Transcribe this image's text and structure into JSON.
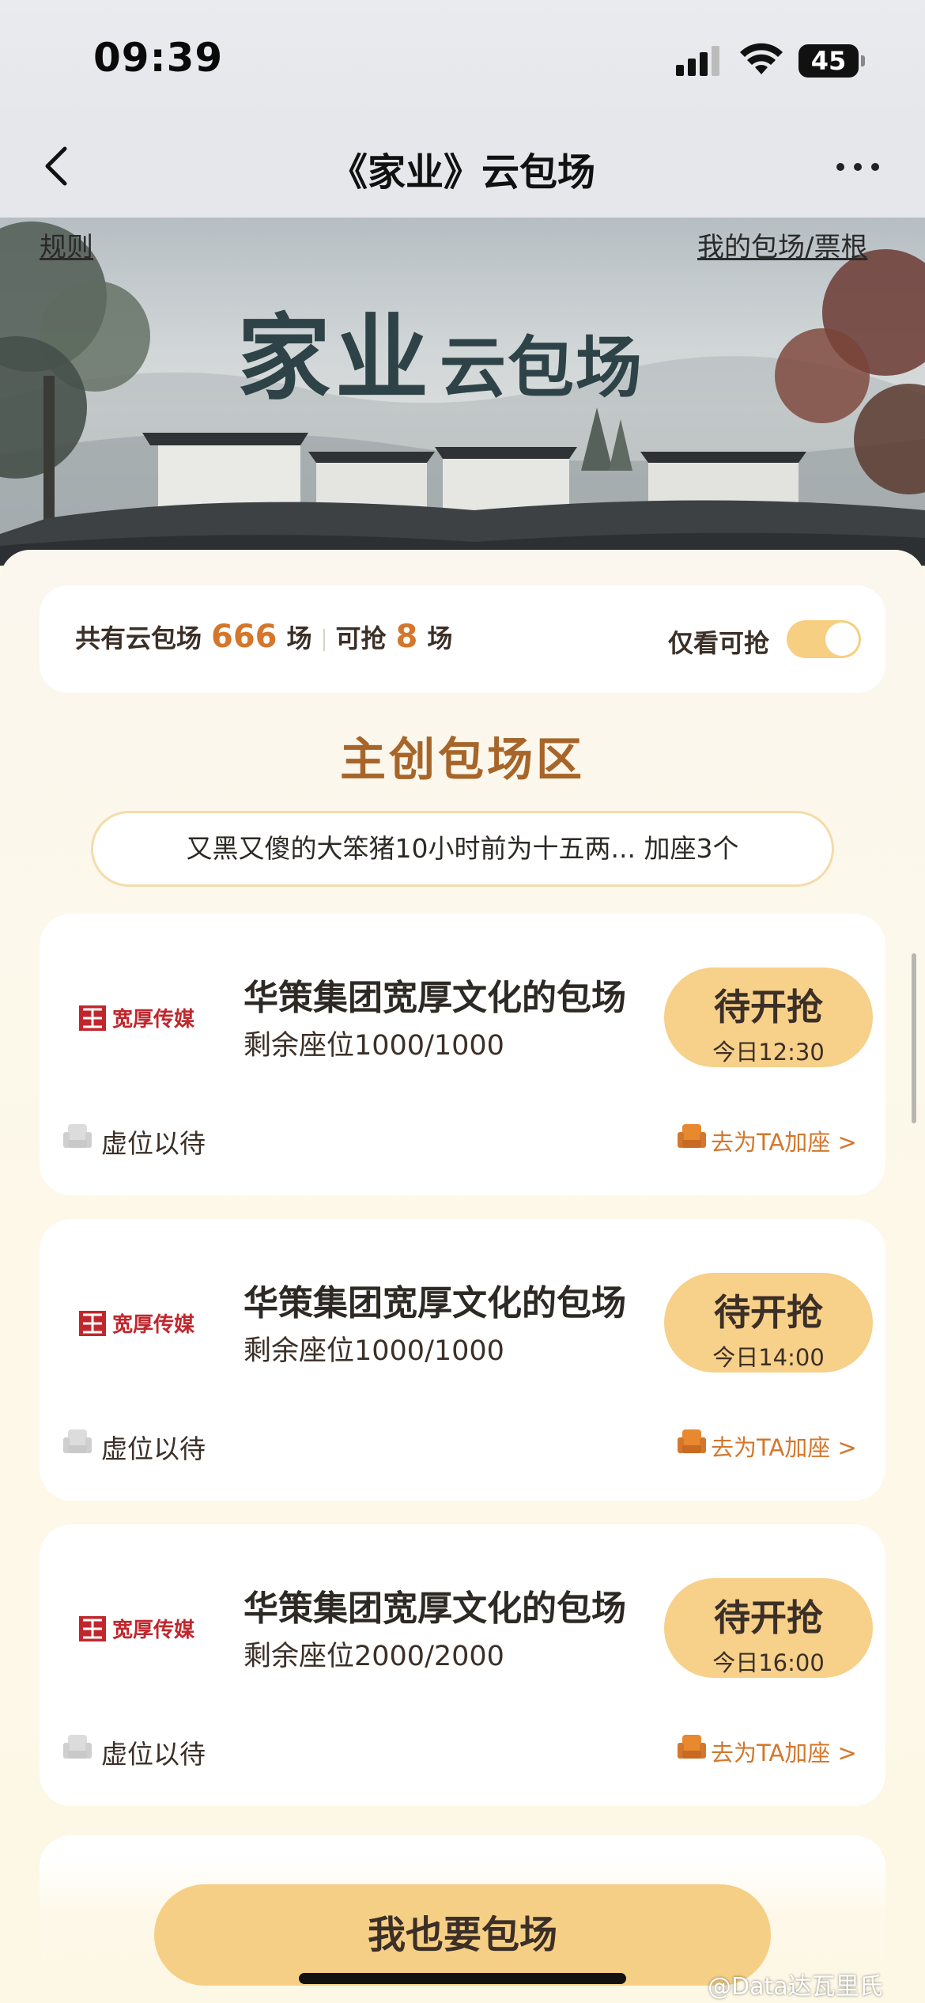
{
  "status_bar": {
    "time": "09:39",
    "battery": "45"
  },
  "nav": {
    "title": "《家业》云包场"
  },
  "banner": {
    "rules_link": "规则",
    "my_link": "我的包场/票根",
    "title_big": "家业",
    "title_small": "云包场"
  },
  "summary": {
    "total_prefix": "共有云包场",
    "total_count": "666",
    "total_unit": "场",
    "avail_prefix": "可抢",
    "avail_count": "8",
    "avail_unit": "场",
    "toggle_label": "仅看可抢",
    "toggle_on": true
  },
  "section_title": "主创包场区",
  "marquee_text": "又黑又傻的大笨猪10小时前为十五两... 加座3个",
  "events": [
    {
      "title": "华策集团宽厚文化的包场",
      "seats": "剩余座位1000/1000",
      "status": "待开抢",
      "time": "今日12:30",
      "wait": "虚位以待",
      "add": "去为TA加座 >"
    },
    {
      "title": "华策集团宽厚文化的包场",
      "seats": "剩余座位1000/1000",
      "status": "待开抢",
      "time": "今日14:00",
      "wait": "虚位以待",
      "add": "去为TA加座 >"
    },
    {
      "title": "华策集团宽厚文化的包场",
      "seats": "剩余座位2000/2000",
      "status": "待开抢",
      "time": "今日16:00",
      "wait": "虚位以待",
      "add": "去为TA加座 >"
    }
  ],
  "logo_text": "宽厚传媒",
  "cta": "我也要包场",
  "watermark": "@Data达瓦里氏",
  "colors": {
    "accent": "#d4772c",
    "button": "#f6cf86",
    "title_brown": "#a7652a",
    "background": "#fdf8ea"
  },
  "icons": [
    "back-chevron-icon",
    "more-icon",
    "sofa-seat-icon",
    "signal-icon",
    "wifi-icon",
    "battery-icon"
  ]
}
